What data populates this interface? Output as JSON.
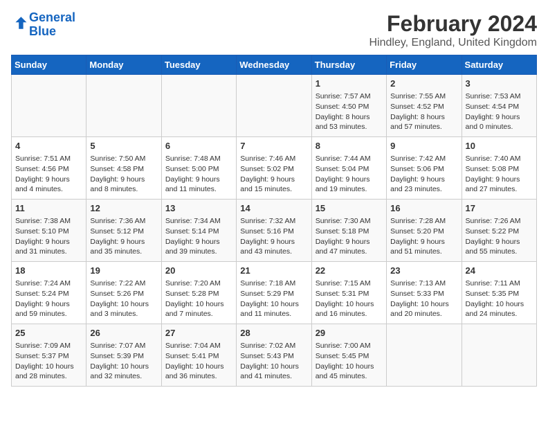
{
  "header": {
    "logo_line1": "General",
    "logo_line2": "Blue",
    "title": "February 2024",
    "subtitle": "Hindley, England, United Kingdom"
  },
  "columns": [
    "Sunday",
    "Monday",
    "Tuesday",
    "Wednesday",
    "Thursday",
    "Friday",
    "Saturday"
  ],
  "weeks": [
    [
      {
        "day": "",
        "sunrise": "",
        "sunset": "",
        "daylight": ""
      },
      {
        "day": "",
        "sunrise": "",
        "sunset": "",
        "daylight": ""
      },
      {
        "day": "",
        "sunrise": "",
        "sunset": "",
        "daylight": ""
      },
      {
        "day": "",
        "sunrise": "",
        "sunset": "",
        "daylight": ""
      },
      {
        "day": "1",
        "sunrise": "Sunrise: 7:57 AM",
        "sunset": "Sunset: 4:50 PM",
        "daylight": "Daylight: 8 hours and 53 minutes."
      },
      {
        "day": "2",
        "sunrise": "Sunrise: 7:55 AM",
        "sunset": "Sunset: 4:52 PM",
        "daylight": "Daylight: 8 hours and 57 minutes."
      },
      {
        "day": "3",
        "sunrise": "Sunrise: 7:53 AM",
        "sunset": "Sunset: 4:54 PM",
        "daylight": "Daylight: 9 hours and 0 minutes."
      }
    ],
    [
      {
        "day": "4",
        "sunrise": "Sunrise: 7:51 AM",
        "sunset": "Sunset: 4:56 PM",
        "daylight": "Daylight: 9 hours and 4 minutes."
      },
      {
        "day": "5",
        "sunrise": "Sunrise: 7:50 AM",
        "sunset": "Sunset: 4:58 PM",
        "daylight": "Daylight: 9 hours and 8 minutes."
      },
      {
        "day": "6",
        "sunrise": "Sunrise: 7:48 AM",
        "sunset": "Sunset: 5:00 PM",
        "daylight": "Daylight: 9 hours and 11 minutes."
      },
      {
        "day": "7",
        "sunrise": "Sunrise: 7:46 AM",
        "sunset": "Sunset: 5:02 PM",
        "daylight": "Daylight: 9 hours and 15 minutes."
      },
      {
        "day": "8",
        "sunrise": "Sunrise: 7:44 AM",
        "sunset": "Sunset: 5:04 PM",
        "daylight": "Daylight: 9 hours and 19 minutes."
      },
      {
        "day": "9",
        "sunrise": "Sunrise: 7:42 AM",
        "sunset": "Sunset: 5:06 PM",
        "daylight": "Daylight: 9 hours and 23 minutes."
      },
      {
        "day": "10",
        "sunrise": "Sunrise: 7:40 AM",
        "sunset": "Sunset: 5:08 PM",
        "daylight": "Daylight: 9 hours and 27 minutes."
      }
    ],
    [
      {
        "day": "11",
        "sunrise": "Sunrise: 7:38 AM",
        "sunset": "Sunset: 5:10 PM",
        "daylight": "Daylight: 9 hours and 31 minutes."
      },
      {
        "day": "12",
        "sunrise": "Sunrise: 7:36 AM",
        "sunset": "Sunset: 5:12 PM",
        "daylight": "Daylight: 9 hours and 35 minutes."
      },
      {
        "day": "13",
        "sunrise": "Sunrise: 7:34 AM",
        "sunset": "Sunset: 5:14 PM",
        "daylight": "Daylight: 9 hours and 39 minutes."
      },
      {
        "day": "14",
        "sunrise": "Sunrise: 7:32 AM",
        "sunset": "Sunset: 5:16 PM",
        "daylight": "Daylight: 9 hours and 43 minutes."
      },
      {
        "day": "15",
        "sunrise": "Sunrise: 7:30 AM",
        "sunset": "Sunset: 5:18 PM",
        "daylight": "Daylight: 9 hours and 47 minutes."
      },
      {
        "day": "16",
        "sunrise": "Sunrise: 7:28 AM",
        "sunset": "Sunset: 5:20 PM",
        "daylight": "Daylight: 9 hours and 51 minutes."
      },
      {
        "day": "17",
        "sunrise": "Sunrise: 7:26 AM",
        "sunset": "Sunset: 5:22 PM",
        "daylight": "Daylight: 9 hours and 55 minutes."
      }
    ],
    [
      {
        "day": "18",
        "sunrise": "Sunrise: 7:24 AM",
        "sunset": "Sunset: 5:24 PM",
        "daylight": "Daylight: 9 hours and 59 minutes."
      },
      {
        "day": "19",
        "sunrise": "Sunrise: 7:22 AM",
        "sunset": "Sunset: 5:26 PM",
        "daylight": "Daylight: 10 hours and 3 minutes."
      },
      {
        "day": "20",
        "sunrise": "Sunrise: 7:20 AM",
        "sunset": "Sunset: 5:28 PM",
        "daylight": "Daylight: 10 hours and 7 minutes."
      },
      {
        "day": "21",
        "sunrise": "Sunrise: 7:18 AM",
        "sunset": "Sunset: 5:29 PM",
        "daylight": "Daylight: 10 hours and 11 minutes."
      },
      {
        "day": "22",
        "sunrise": "Sunrise: 7:15 AM",
        "sunset": "Sunset: 5:31 PM",
        "daylight": "Daylight: 10 hours and 16 minutes."
      },
      {
        "day": "23",
        "sunrise": "Sunrise: 7:13 AM",
        "sunset": "Sunset: 5:33 PM",
        "daylight": "Daylight: 10 hours and 20 minutes."
      },
      {
        "day": "24",
        "sunrise": "Sunrise: 7:11 AM",
        "sunset": "Sunset: 5:35 PM",
        "daylight": "Daylight: 10 hours and 24 minutes."
      }
    ],
    [
      {
        "day": "25",
        "sunrise": "Sunrise: 7:09 AM",
        "sunset": "Sunset: 5:37 PM",
        "daylight": "Daylight: 10 hours and 28 minutes."
      },
      {
        "day": "26",
        "sunrise": "Sunrise: 7:07 AM",
        "sunset": "Sunset: 5:39 PM",
        "daylight": "Daylight: 10 hours and 32 minutes."
      },
      {
        "day": "27",
        "sunrise": "Sunrise: 7:04 AM",
        "sunset": "Sunset: 5:41 PM",
        "daylight": "Daylight: 10 hours and 36 minutes."
      },
      {
        "day": "28",
        "sunrise": "Sunrise: 7:02 AM",
        "sunset": "Sunset: 5:43 PM",
        "daylight": "Daylight: 10 hours and 41 minutes."
      },
      {
        "day": "29",
        "sunrise": "Sunrise: 7:00 AM",
        "sunset": "Sunset: 5:45 PM",
        "daylight": "Daylight: 10 hours and 45 minutes."
      },
      {
        "day": "",
        "sunrise": "",
        "sunset": "",
        "daylight": ""
      },
      {
        "day": "",
        "sunrise": "",
        "sunset": "",
        "daylight": ""
      }
    ]
  ]
}
